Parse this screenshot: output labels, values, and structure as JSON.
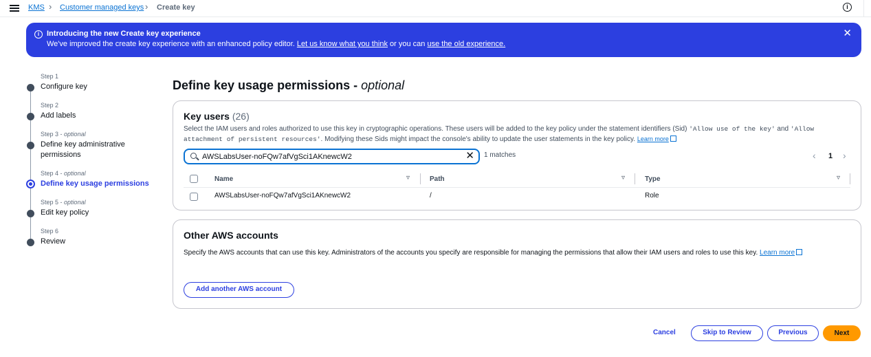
{
  "breadcrumb": {
    "kms": "KMS",
    "cmk": "Customer managed keys",
    "current": "Create key"
  },
  "banner": {
    "title": "Introducing the new Create key experience",
    "text_prefix": "We've improved the create key experience with an enhanced policy editor.",
    "link1": "Let us know what you think",
    "text_middle": "or you can",
    "link2": "use the old experience."
  },
  "steps": [
    {
      "num": "Step 1",
      "opt": "",
      "label": "Configure key"
    },
    {
      "num": "Step 2",
      "opt": "",
      "label": "Add labels"
    },
    {
      "num": "Step 3 -",
      "opt": "optional",
      "label": "Define key administrative permissions"
    },
    {
      "num": "Step 4 -",
      "opt": "optional",
      "label": "Define key usage permissions"
    },
    {
      "num": "Step 5 -",
      "opt": "optional",
      "label": "Edit key policy"
    },
    {
      "num": "Step 6",
      "opt": "",
      "label": "Review"
    }
  ],
  "page": {
    "title": "Define key usage permissions -",
    "title_opt": "optional"
  },
  "key_users": {
    "title": "Key users",
    "count": "(26)",
    "desc_1": "Select the IAM users and roles authorized to use this key in cryptographic operations. These users will be added to the key policy under the statement identifiers (Sid)",
    "sid_1": "'Allow use of the key'",
    "desc_and": "and",
    "sid_2": "'Allow attachment of persistent resources'",
    "desc_2": ". Modifying these Sids might impact the console's ability to update the user statements in the key policy.",
    "learn_more": "Learn more",
    "search_value": "AWSLabsUser-noFQw7afVgSci1AKnewcW2",
    "matches": "1 matches",
    "page": "1",
    "columns": [
      "Name",
      "Path",
      "Type"
    ],
    "rows": [
      {
        "name": "AWSLabsUser-noFQw7afVgSci1AKnewcW2",
        "path": "/",
        "type": "Role"
      }
    ]
  },
  "other_accounts": {
    "title": "Other AWS accounts",
    "desc": "Specify the AWS accounts that can use this key. Administrators of the accounts you specify are responsible for managing the permissions that allow their IAM users and roles to use this key.",
    "learn_more": "Learn more",
    "add_button": "Add another AWS account"
  },
  "footer": {
    "cancel": "Cancel",
    "skip": "Skip to Review",
    "previous": "Previous",
    "next": "Next"
  },
  "colors": {
    "primary": "#2c3fe0",
    "accent": "#ff9900",
    "link": "#0972d3"
  }
}
